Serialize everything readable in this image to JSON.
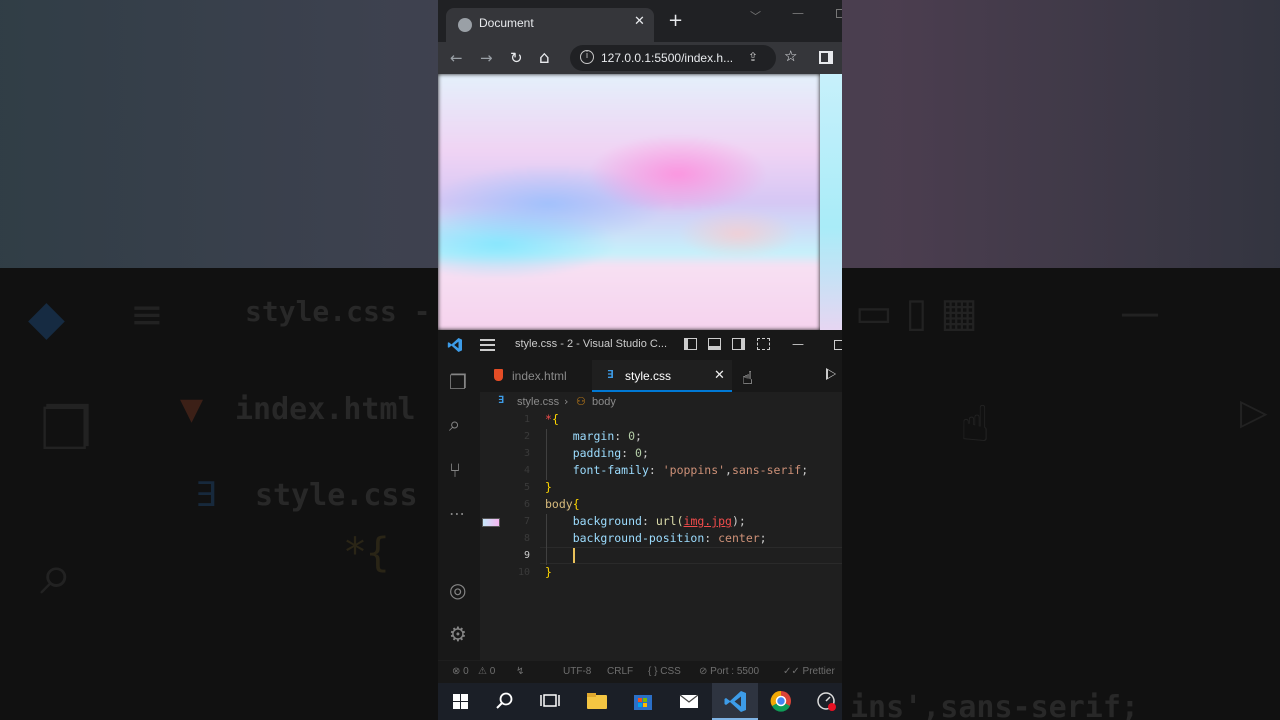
{
  "browser": {
    "tab_title": "Document",
    "tab_close": "✕",
    "new_tab": "+",
    "address": "127.0.0.1:5500/index.h...",
    "nav": {
      "back": "←",
      "forward": "→",
      "reload": "↻",
      "home": "⌂"
    }
  },
  "vscode": {
    "title": "style.css - 2 - Visual Studio C...",
    "tabs": [
      {
        "label": "index.html",
        "icon": "html5-icon",
        "active": false
      },
      {
        "label": "style.css",
        "icon": "css-icon",
        "active": true,
        "close": "✕"
      }
    ],
    "breadcrumb": {
      "file": "style.css",
      "separator": "›",
      "symbol": "body"
    },
    "line_numbers": [
      "1",
      "2",
      "3",
      "4",
      "5",
      "6",
      "7",
      "8",
      "9",
      "10"
    ],
    "current_line": "9",
    "code": {
      "l1_sel": "*",
      "l1_brace": "{",
      "l2_prop": "margin",
      "l2_val": "0",
      "l3_prop": "padding",
      "l3_val": "0",
      "l4_prop": "font-family",
      "l4_str": "'poppins'",
      "l4_val": "sans-serif",
      "l5_brace": "}",
      "l6_sel": "body",
      "l6_brace": "{",
      "l7_prop": "background",
      "l7_fn": "url(",
      "l7_arg": "img.jpg",
      "l7_close": ");",
      "l8_prop": "background-position",
      "l8_val": "center",
      "l10_brace": "}"
    },
    "status": {
      "errors": "⊗ 0",
      "warnings": "⚠ 0",
      "encoding": "UTF-8",
      "eol": "CRLF",
      "language": "{ } CSS",
      "port": "⊘ Port : 5500",
      "prettier": "✓✓ Prettier"
    }
  },
  "backdrop": {
    "title": "style.css - 2",
    "tab1": "index.html",
    "tab2": "style.css",
    "code": "ins',sans-serif;"
  },
  "taskbar": {
    "apps": [
      "windows-start",
      "search",
      "task-view",
      "file-explorer",
      "microsoft-store",
      "mail",
      "vs-code",
      "chrome",
      "clock-app"
    ]
  },
  "colors": {
    "accent": "#0078d4",
    "html_icon": "#e44d26",
    "css_icon": "#3d9ce8"
  }
}
